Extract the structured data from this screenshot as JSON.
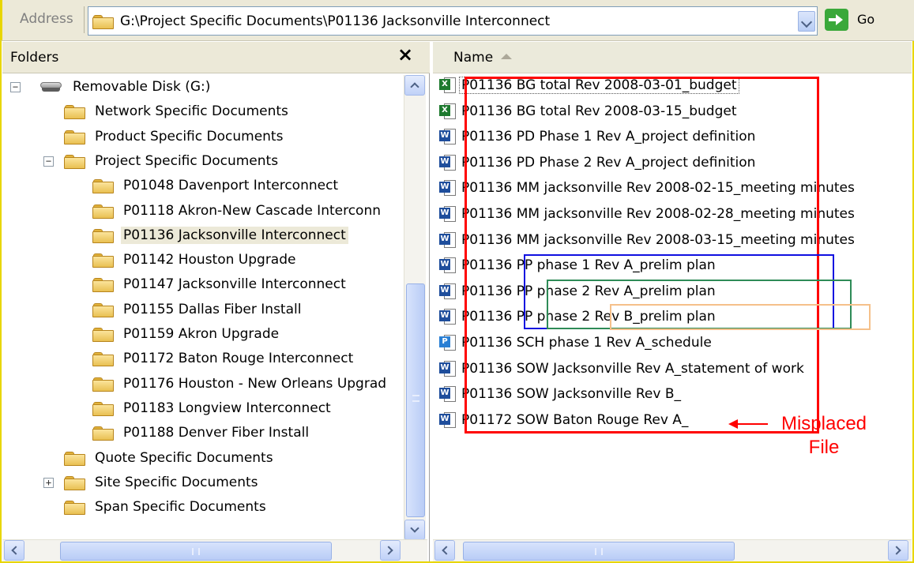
{
  "address_bar": {
    "label": "Address",
    "path": "G:\\Project Specific Documents\\P01136 Jacksonville Interconnect",
    "go_label": "Go"
  },
  "folders_pane": {
    "title": "Folders",
    "close_glyph": "×",
    "tree": [
      {
        "label": "Removable Disk (G:)",
        "type": "disk",
        "expander": "−"
      },
      {
        "label": "Network Specific Documents",
        "type": "folder"
      },
      {
        "label": "Product Specific Documents",
        "type": "folder"
      },
      {
        "label": "Project Specific Documents",
        "type": "folder",
        "expander": "−"
      },
      {
        "label": "P01048 Davenport Interconnect",
        "type": "folder"
      },
      {
        "label": "P01118 Akron-New Cascade Interconn",
        "type": "folder"
      },
      {
        "label": "P01136 Jacksonville Interconnect",
        "type": "folder",
        "selected": true
      },
      {
        "label": "P01142 Houston Upgrade",
        "type": "folder"
      },
      {
        "label": "P01147 Jacksonville Interconnect",
        "type": "folder"
      },
      {
        "label": "P01155 Dallas Fiber Install",
        "type": "folder"
      },
      {
        "label": "P01159 Akron Upgrade",
        "type": "folder"
      },
      {
        "label": "P01172 Baton Rouge Interconnect",
        "type": "folder"
      },
      {
        "label": "P01176 Houston - New Orleans Upgrad",
        "type": "folder"
      },
      {
        "label": "P01183 Longview Interconnect",
        "type": "folder"
      },
      {
        "label": "P01188 Denver Fiber Install",
        "type": "folder"
      },
      {
        "label": "Quote Specific Documents",
        "type": "folder"
      },
      {
        "label": "Site Specific Documents",
        "type": "folder",
        "expander": "+"
      },
      {
        "label": "Span Specific Documents",
        "type": "folder"
      }
    ]
  },
  "files_pane": {
    "column_header": "Name",
    "files": [
      {
        "name": "P01136 BG total Rev 2008-03-01_budget",
        "icon": "excel-icon",
        "badge": "X"
      },
      {
        "name": "P01136 BG total Rev 2008-03-15_budget",
        "icon": "excel-icon",
        "badge": "X"
      },
      {
        "name": "P01136 PD Phase 1 Rev A_project definition",
        "icon": "word-icon",
        "badge": "W"
      },
      {
        "name": "P01136 PD Phase 2 Rev A_project definition",
        "icon": "word-icon",
        "badge": "W"
      },
      {
        "name": "P01136 MM jacksonville Rev 2008-02-15_meeting minutes",
        "icon": "word-icon",
        "badge": "W"
      },
      {
        "name": "P01136 MM jacksonville Rev 2008-02-28_meeting minutes",
        "icon": "word-icon",
        "badge": "W"
      },
      {
        "name": "P01136 MM jacksonville Rev 2008-03-15_meeting minutes",
        "icon": "word-icon",
        "badge": "W"
      },
      {
        "name": "P01136 PP phase 1 Rev A_prelim plan",
        "icon": "word-icon",
        "badge": "W"
      },
      {
        "name": "P01136 PP phase 2 Rev A_prelim plan",
        "icon": "word-icon",
        "badge": "W"
      },
      {
        "name": "P01136 PP phase 2 Rev B_prelim plan",
        "icon": "word-icon",
        "badge": "W"
      },
      {
        "name": "P01136 SCH phase 1 Rev A_schedule",
        "icon": "project-icon",
        "badge": "P"
      },
      {
        "name": "P01136 SOW Jacksonville Rev A_statement of work",
        "icon": "word-icon",
        "badge": "W"
      },
      {
        "name": "P01136 SOW Jacksonville Rev B_",
        "icon": "word-icon",
        "badge": "W"
      },
      {
        "name": "P01172 SOW Baton Rouge Rev A_",
        "icon": "word-icon",
        "badge": "W"
      }
    ]
  },
  "annotation": {
    "label_line1": "Misplaced",
    "label_line2": "File",
    "colors": {
      "red": "#ff0000",
      "blue": "#1010e0",
      "green": "#2e8b57",
      "orange": "#f5c08a"
    }
  }
}
